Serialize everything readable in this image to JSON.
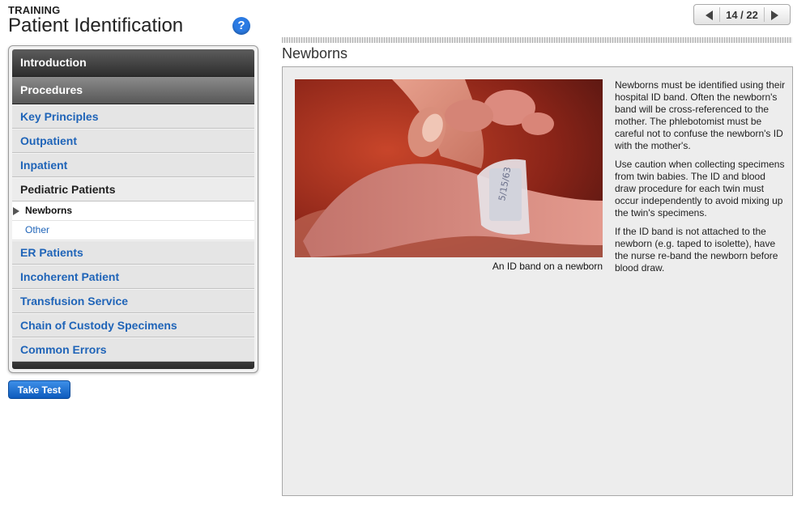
{
  "header": {
    "label": "TRAINING",
    "title": "Patient Identification",
    "help_icon": "?"
  },
  "sidebar": {
    "sections": [
      "Introduction",
      "Procedures"
    ],
    "items": [
      {
        "label": "Key Principles"
      },
      {
        "label": "Outpatient"
      },
      {
        "label": "Inpatient"
      },
      {
        "label": "Pediatric Patients"
      },
      {
        "label": "ER Patients"
      },
      {
        "label": "Incoherent Patient"
      },
      {
        "label": "Transfusion Service"
      },
      {
        "label": "Chain of Custody Specimens"
      },
      {
        "label": "Common Errors"
      }
    ],
    "subitems": [
      {
        "label": "Newborns",
        "active": true
      },
      {
        "label": "Other",
        "active": false
      }
    ]
  },
  "buttons": {
    "take_test": "Take Test"
  },
  "pager": {
    "current": 14,
    "total": 22,
    "text": "14 / 22"
  },
  "main": {
    "section_title": "Newborns",
    "image_caption": "An ID band on a newborn",
    "paragraphs": [
      "Newborns must be identified using their hospital ID band. Often the newborn's band will be cross-referenced to the mother. The phlebotomist must be careful not to confuse the newborn's ID with the mother's.",
      "Use caution when collecting specimens from twin babies. The ID and blood draw procedure for each twin must occur independently to avoid mixing up the twin's specimens.",
      "If the ID band is not attached to the newborn (e.g. taped to isolette), have the nurse re-band the newborn before blood draw."
    ]
  },
  "colors": {
    "link_blue": "#1f64b8",
    "help_blue": "#2b7be4",
    "header_dark": "#2e2e2e",
    "content_bg": "#ededed"
  }
}
